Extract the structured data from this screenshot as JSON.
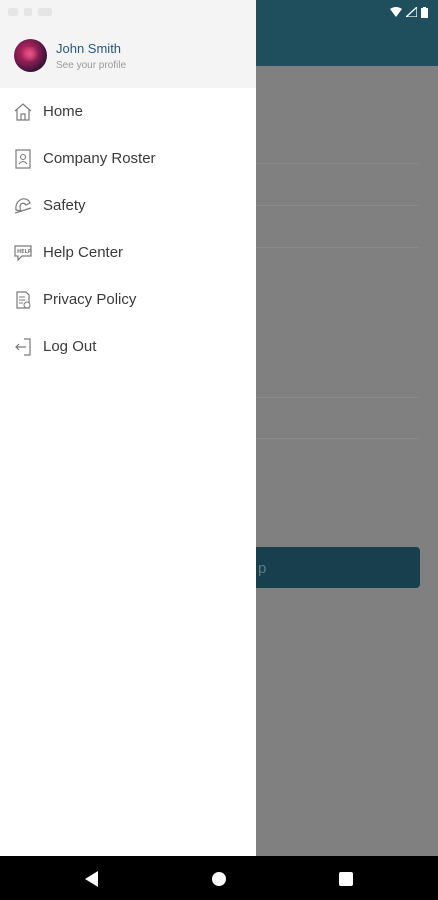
{
  "profile": {
    "name": "John Smith",
    "subtitle": "See your profile"
  },
  "menu": {
    "items": [
      {
        "label": "Home",
        "icon": "home-icon"
      },
      {
        "label": "Company Roster",
        "icon": "roster-icon"
      },
      {
        "label": "Safety",
        "icon": "safety-icon"
      },
      {
        "label": "Help Center",
        "icon": "help-icon"
      },
      {
        "label": "Privacy Policy",
        "icon": "privacy-icon"
      },
      {
        "label": "Log Out",
        "icon": "logout-icon"
      }
    ]
  },
  "background": {
    "button_label": "p"
  },
  "colors": {
    "appbar": "#1f4f5d",
    "accent_text": "#2a5878",
    "button": "#173f4d"
  }
}
